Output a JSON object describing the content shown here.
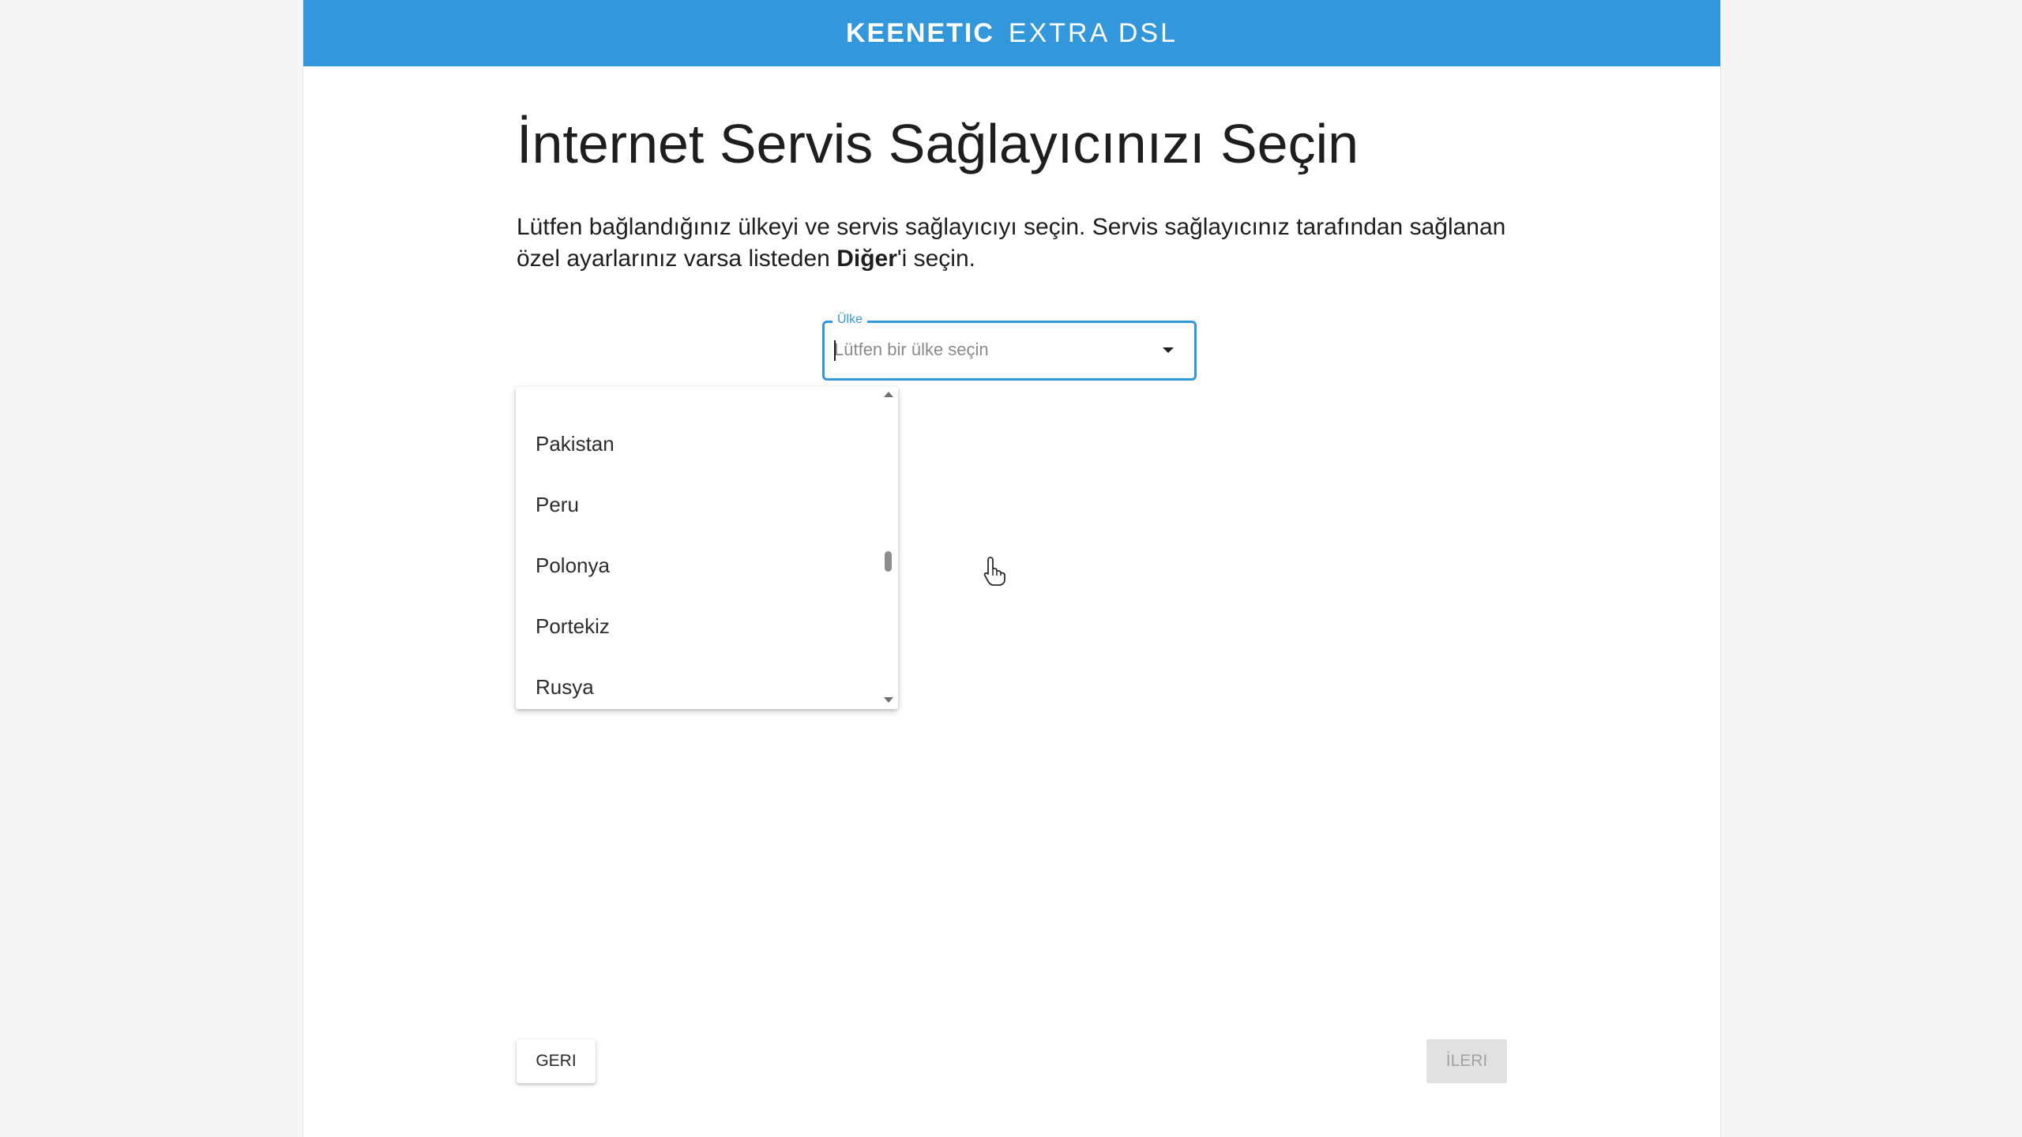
{
  "header": {
    "brand": "KEENETIC",
    "model": "EXTRA DSL",
    "background": "#3398db"
  },
  "page": {
    "title": "İnternet Servis Sağlayıcınızı Seçin",
    "description_before": "Lütfen bağlandığınız ülkeyi ve servis sağlayıcıyı seçin. Servis sağlayıcınız tarafından sağlanan özel ayarlarınız varsa listeden ",
    "description_bold": "Diğer",
    "description_after": "'i seçin."
  },
  "country_select": {
    "label": "Ülke",
    "placeholder": "Lütfen bir ülke seçin",
    "value": "",
    "expanded": true,
    "options": [
      "Pakistan",
      "Peru",
      "Polonya",
      "Portekiz",
      "Rusya"
    ],
    "scroll_position": 0.55
  },
  "footer": {
    "back_label": "GERI",
    "next_label": "İLERI",
    "next_disabled": true
  },
  "icons": {
    "dropdown": "chevron-down-icon",
    "scroll_up": "scroll-up-arrow-icon",
    "scroll_down": "scroll-down-arrow-icon",
    "cursor": "hand-pointer-icon"
  }
}
